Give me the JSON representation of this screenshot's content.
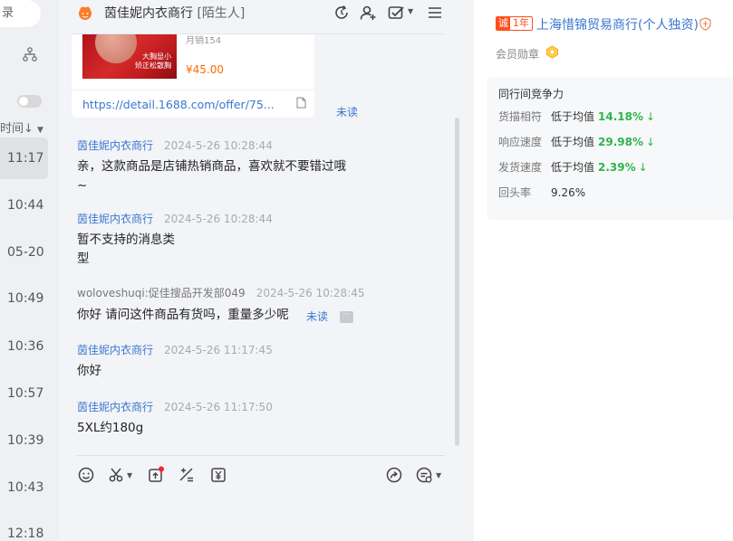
{
  "left": {
    "login_fragment": "录",
    "sort_label": "时间↓",
    "times": [
      "11:17",
      "10:44",
      "05-20",
      "10:49",
      "10:36",
      "10:57",
      "10:39",
      "10:43",
      "12:18"
    ]
  },
  "chat": {
    "title": "茵佳妮内衣商行",
    "title_tag": "[陌生人]",
    "card": {
      "title_cut": "月销154",
      "image_text_1": "大胸显小",
      "image_text_2": "矫正松散胸",
      "price": "¥45.00",
      "link": "https://detail.1688.com/offer/75..."
    },
    "unread_label": "未读",
    "messages": [
      {
        "sender": "茵佳妮内衣商行",
        "time": "2024-5-26 10:28:44",
        "text": "亲，这款商品是店铺热销商品，喜欢就不要错过哦",
        "text2": "~"
      },
      {
        "sender": "茵佳妮内衣商行",
        "time": "2024-5-26 10:28:44",
        "text": "暂不支持的消息类",
        "text2": "型"
      },
      {
        "sender": "woloveshuqi:促佳搜品开发部049",
        "time": "2024-5-26 10:28:45",
        "text": "你好 请问这件商品有货吗，重量多少呢"
      },
      {
        "sender": "茵佳妮内衣商行",
        "time": "2024-5-26 11:17:45",
        "text": "你好"
      },
      {
        "sender": "茵佳妮内衣商行",
        "time": "2024-5-26 11:17:50",
        "text": "5XL约180g"
      }
    ]
  },
  "right": {
    "tp_label": "诚",
    "years_label": "1年",
    "company": "上海惜锦贸易商行(个人独资)",
    "medal_label": "会员勋章",
    "competition": {
      "title": "同行间竞争力",
      "rows": [
        {
          "label": "货描相符",
          "text": "低于均值",
          "value": "14.18%"
        },
        {
          "label": "响应速度",
          "text": "低于均值",
          "value": "29.98%"
        },
        {
          "label": "发货速度",
          "text": "低于均值",
          "value": "2.39%"
        },
        {
          "label": "回头率",
          "value": "9.26%"
        }
      ]
    }
  },
  "colors": {
    "link": "#3a76d1",
    "accent_orange": "#ff6a00",
    "good_green": "#2db44b",
    "trust_badge": "#ff4d1c"
  },
  "icons": [
    "org-chart-icon",
    "refresh-icon",
    "add-user-icon",
    "task-check-icon",
    "menu-icon",
    "emoji-icon",
    "scissors-icon",
    "upload-icon",
    "calculator-icon",
    "price-icon",
    "share-icon",
    "quick-reply-icon",
    "medal-icon",
    "guarantee-icon",
    "document-icon",
    "more-icon"
  ]
}
